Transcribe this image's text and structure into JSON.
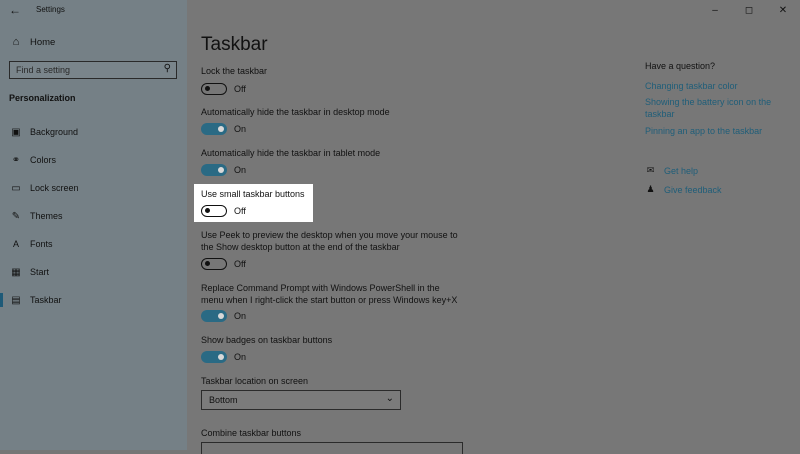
{
  "window": {
    "title": "Settings",
    "back_icon": "back-arrow-icon",
    "controls": [
      "–",
      "◻",
      "✕"
    ]
  },
  "sidebar": {
    "home": "Home",
    "search_placeholder": "Find a setting",
    "category": "Personalization",
    "items": [
      {
        "label": "Background",
        "icon": "picture-icon"
      },
      {
        "label": "Colors",
        "icon": "palette-icon"
      },
      {
        "label": "Lock screen",
        "icon": "lock-screen-icon"
      },
      {
        "label": "Themes",
        "icon": "brush-icon"
      },
      {
        "label": "Fonts",
        "icon": "font-icon"
      },
      {
        "label": "Start",
        "icon": "start-icon"
      },
      {
        "label": "Taskbar",
        "icon": "taskbar-icon",
        "active": true
      }
    ]
  },
  "main": {
    "title": "Taskbar",
    "settings": [
      {
        "label": "Lock the taskbar",
        "state": "Off"
      },
      {
        "label": "Automatically hide the taskbar in desktop mode",
        "state": "On"
      },
      {
        "label": "Automatically hide the taskbar in tablet mode",
        "state": "On"
      },
      {
        "label": "Use small taskbar buttons",
        "state": "Off",
        "highlighted": true
      },
      {
        "label": "Use Peek to preview the desktop when you move your mouse to the Show desktop button at the end of the taskbar",
        "state": "Off"
      },
      {
        "label": "Replace Command Prompt with Windows PowerShell in the menu when I right-click the start button or press Windows key+X",
        "state": "On"
      },
      {
        "label": "Show badges on taskbar buttons",
        "state": "On"
      }
    ],
    "location_label": "Taskbar location on screen",
    "location_value": "Bottom",
    "combine_label": "Combine taskbar buttons"
  },
  "right": {
    "question_title": "Have a question?",
    "links": [
      "Changing taskbar color",
      "Showing the battery icon on the taskbar",
      "Pinning an app to the taskbar"
    ],
    "get_help": "Get help",
    "give_feedback": "Give feedback"
  },
  "colors": {
    "toggle_on": "#2a6a84",
    "link": "#1f5e79",
    "highlight": "#ffffff"
  }
}
